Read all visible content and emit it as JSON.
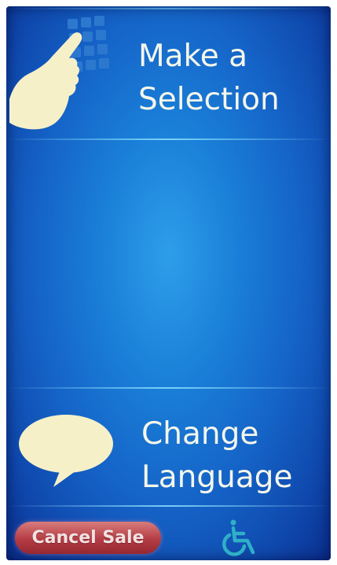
{
  "main_menu": {
    "selection_line1": "Make a",
    "selection_line2": "Selection",
    "language_line1": "Change",
    "language_line2": "Language"
  },
  "footer": {
    "cancel_label": "Cancel Sale"
  },
  "icons": {
    "selection": "hand-keypad-icon",
    "language": "speech-bubble-icon",
    "accessibility": "wheelchair-icon"
  },
  "colors": {
    "screen_blue": "#1a7fd8",
    "label_text": "#f4f6ea",
    "icon_cream": "#f6f0c8",
    "cancel_red": "#b43c44",
    "accessibility_teal": "#2fb0c6",
    "divider_cyan": "#8ce1ff"
  }
}
